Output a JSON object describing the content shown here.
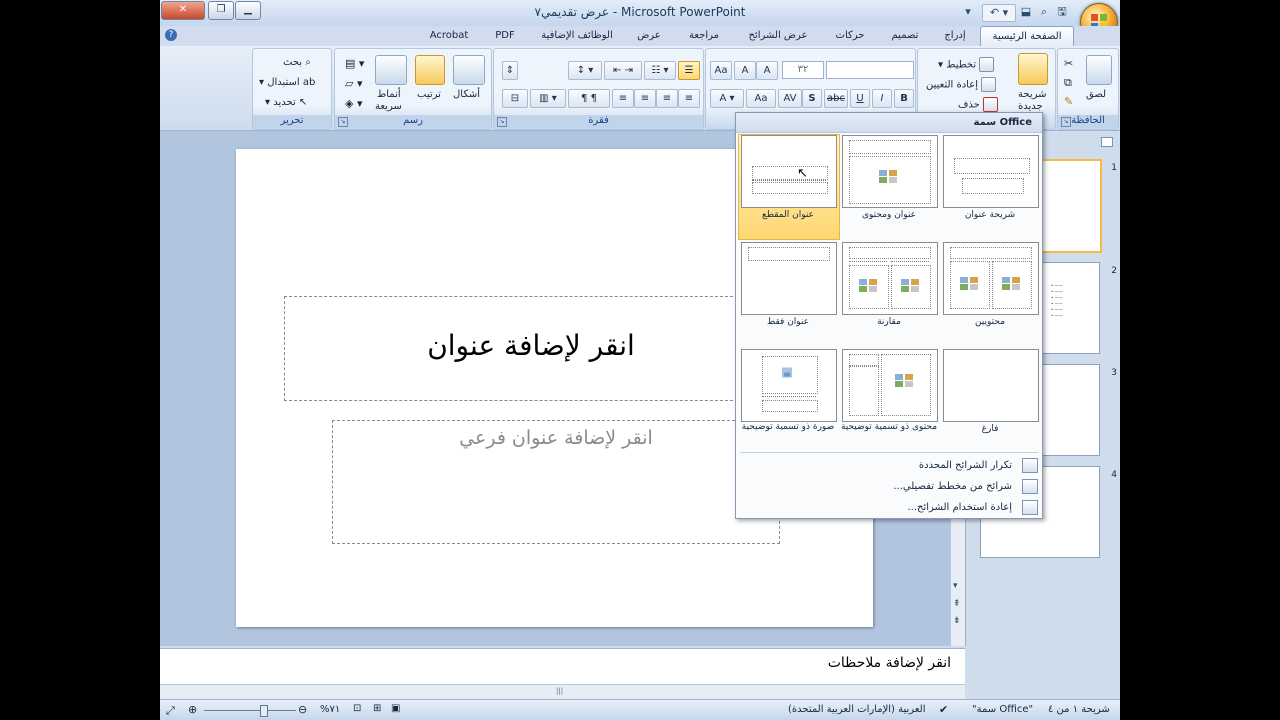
{
  "window": {
    "title": "عرض تقديمي٧ - Microsoft PowerPoint"
  },
  "tabs": [
    "الصفحة الرئيسية",
    "إدراج",
    "تصميم",
    "حركات",
    "عرض الشرائح",
    "مراجعة",
    "عرض",
    "الوظائف الإضافية",
    "PDF",
    "Acrobat"
  ],
  "ribbon": {
    "clipboard": {
      "group": "الحافظة",
      "paste": "لصق"
    },
    "slides": {
      "new_slide_1": "شريحة",
      "new_slide_2": "جديدة",
      "layout": "تخطيط",
      "reset": "إعادة التعيين",
      "delete": "حذف"
    },
    "font": {
      "size_value": "٣٢",
      "bold": "B",
      "italic": "I",
      "underline": "U",
      "strike": "abc",
      "shadow": "S",
      "spacing": "AV",
      "case": "Aa"
    },
    "paragraph": {
      "group": "فقرة"
    },
    "drawing": {
      "group": "رسم",
      "shapes": "أشكال",
      "arrange": "ترتيب",
      "quick_styles_1": "أنماط",
      "quick_styles_2": "سريعة"
    },
    "editing": {
      "group": "تحرير",
      "find": "بحث",
      "replace": "استبدال",
      "select": "تحديد"
    }
  },
  "slide": {
    "title_placeholder": "انقر لإضافة عنوان",
    "subtitle_placeholder": "انقر لإضافة عنوان فرعي"
  },
  "notes": {
    "placeholder": "انقر لإضافة ملاحظات"
  },
  "thumbnails": [
    "1",
    "2",
    "3",
    "4"
  ],
  "layout_menu": {
    "header": "سمة Office",
    "layouts": [
      {
        "name": "شريحة عنوان"
      },
      {
        "name": "عنوان ومحتوى"
      },
      {
        "name": "عنوان المقطع",
        "selected": true
      },
      {
        "name": "محتويين"
      },
      {
        "name": "مقارنة"
      },
      {
        "name": "عنوان فقط"
      },
      {
        "name": "فارغ"
      },
      {
        "name": "محتوى ذو تسمية توضيحية"
      },
      {
        "name": "صورة ذو تسمية توضيحية"
      }
    ],
    "actions": [
      "تكرار الشرائح المحددة",
      "شرائح من مخطط تفصيلي...",
      "إعادة استخدام الشرائح..."
    ]
  },
  "status": {
    "slide_info": "شريحة ١ من ٤",
    "theme": "\"سمة Office\"",
    "language": "العربية (الإمارات العربية المتحدة)",
    "zoom": "%٧١"
  },
  "colors": {
    "accent": "#f6b94a",
    "ribbon_bg": "#d4e1f1",
    "selected_layout": "#ffd770"
  }
}
